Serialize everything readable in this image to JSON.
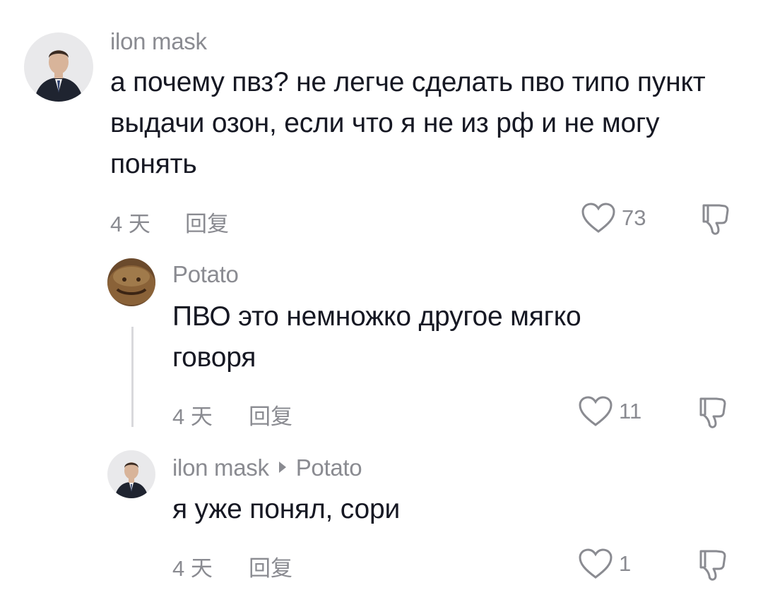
{
  "comments": [
    {
      "username": "ilon mask",
      "text": "а почему пвз? не легче сделать пво типо пункт выдачи озон, если что я не из рф и не могу понять",
      "time": "4 天",
      "reply_label": "回复",
      "likes": "73"
    },
    {
      "username": "Potato",
      "text": "ПВО это немножко другое мягко говоря",
      "time": "4 天",
      "reply_label": "回复",
      "likes": "11"
    },
    {
      "username": "ilon mask",
      "reply_to": "Potato",
      "text": "я уже понял, сори",
      "time": "4 天",
      "reply_label": "回复",
      "likes": "1"
    }
  ],
  "icons": {
    "like": "heart-outline-icon",
    "dislike": "thumbs-down-outline-icon",
    "reply_arrow": "triangle-right-icon"
  },
  "colors": {
    "text": "#161823",
    "muted": "#8a8b91",
    "background": "#ffffff",
    "thread_line": "#d9d9dc"
  }
}
